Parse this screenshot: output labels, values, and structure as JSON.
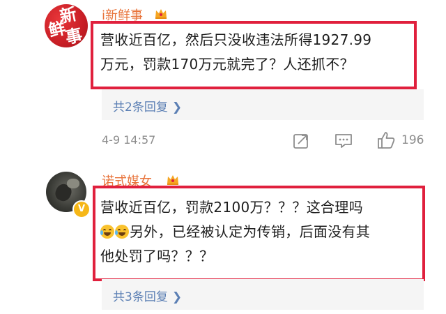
{
  "comments": [
    {
      "avatar_text": [
        "新",
        "鲜",
        "事"
      ],
      "username": "i新鲜事",
      "text_lines": [
        "营收近百亿，然后只没收违法所得1927.99",
        "万元，罚款170万元就完了？人还抓不？"
      ],
      "replies": "共2条回复",
      "time": "4-9 14:57",
      "likes": "196"
    },
    {
      "username": "诺式媒女",
      "text_lines": [
        "营收近百亿，罚款2100万？？？这合理吗",
        "另外，已经被认定为传销，后面没有其",
        "他处罚了吗？？？"
      ],
      "emoji_names": [
        "laugh-cry-emoji",
        "laugh-cry-emoji"
      ],
      "replies": "共3条回复"
    }
  ],
  "icons": {
    "reply_chevron": "chevron-right-icon",
    "share": "share-icon",
    "comment": "comment-icon",
    "like": "thumbs-up-icon",
    "verified": "verified-v-badge-icon",
    "crown": "crown-badge-icon"
  },
  "colors": {
    "username": "#e8733a",
    "highlight_box": "#e0203d",
    "reply_link": "#5b7fb4",
    "meta": "#8c8c8c"
  }
}
